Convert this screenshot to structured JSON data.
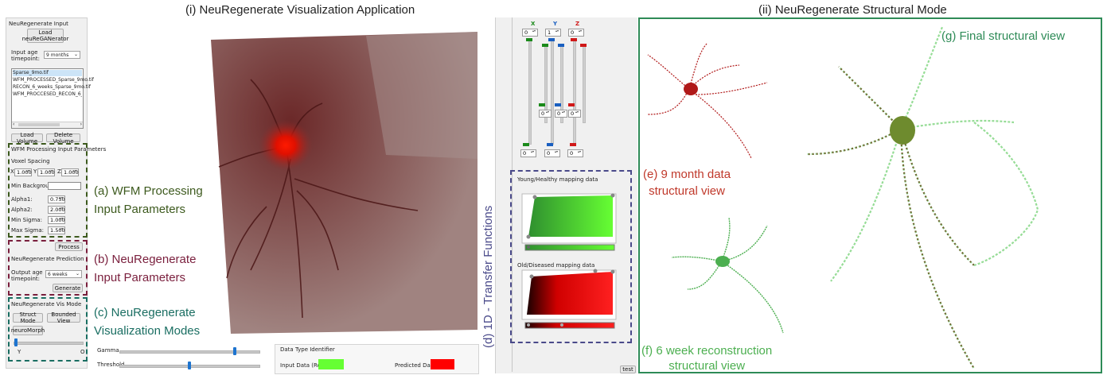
{
  "headers": {
    "app_title": "(i) NeuRegenerate Visualization Application",
    "struct_title": "(ii) NeuRegenerate Structural Mode"
  },
  "left_panel": {
    "group_title": "NeuRegenerate Input",
    "load_button": "Load\nneuReGANerator",
    "input_age_label": "Input age\ntimepoint:",
    "input_age_value": "9 months",
    "volumes": [
      "Sparse_9mo.tif",
      "WFM_PROCESSED_Sparse_9mo.tif",
      "RECON_6_weeks_Sparse_9mo.tif",
      "WFM_PROCCESED_RECON_6_wee"
    ],
    "load_volume": "Load Volume",
    "delete_volume": "Delete Volume",
    "wfm_title": "WFM Processing Input Parameters",
    "voxel_spacing_label": "Voxel Spacing",
    "voxel": {
      "x_label": "X",
      "y_label": "Y",
      "z_label": "Z",
      "x": "1.000",
      "y": "1.000",
      "z": "1.000"
    },
    "min_background_label": "Min Background:",
    "alpha1_label": "Alpha1:",
    "alpha1": "0.750",
    "alpha2_label": "Alpha2:",
    "alpha2": "2.000",
    "min_sigma_label": "Min Sigma:",
    "min_sigma": "1.000",
    "max_sigma_label": "Max Sigma:",
    "max_sigma": "1.500",
    "process_button": "Process",
    "prediction_title": "NeuRegenerate Prediction",
    "output_age_label": "Output age\ntimepoint:",
    "output_age_value": "6 weeks",
    "generate_button": "Generate",
    "vis_title": "NeuRegenerate Vis Mode",
    "struct_mode": "Struct Mode",
    "bounded_view": "Bounded View",
    "neuro_morph": "neuroMorph",
    "slider_left_label": "Y",
    "slider_right_label": "O",
    "slider_value": 0.03
  },
  "annotations": {
    "a_line1": "(a) WFM Processing",
    "a_line2": "Input Parameters",
    "b_line1": "(b) NeuRegenerate",
    "b_line2": "Input Parameters",
    "c_line1": "(c) NeuRegenerate",
    "c_line2": "Visualization Modes",
    "d": "(d) 1D - Transfer Functions",
    "e_line1": "(e) 9 month data",
    "e_line2": "structural view",
    "f_line1": "(f) 6 week reconstruction",
    "f_line2": "structural view",
    "g": "(g) Final structural view",
    "colors": {
      "a": "#3d5a1e",
      "b": "#7a1f3d",
      "c": "#1a6e62",
      "d": "#4a4a8a",
      "e": "#c0392b",
      "f": "#4caf50",
      "g": "#2e8b57"
    }
  },
  "bottom_bar": {
    "gamma_label": "Gamma",
    "gamma_value": 0.83,
    "threshold_label": "Threshold",
    "threshold_value": 0.5,
    "data_type_title": "Data Type Identifier",
    "input_data_label": "Input Data (Real):",
    "predicted_label": "Predicted Data",
    "input_color": "#66ff33",
    "predicted_color": "#ff0000"
  },
  "color_controls": {
    "x_label": "X",
    "y_label": "Y",
    "z_label": "Z",
    "x_color": "#1a8a1a",
    "y_color": "#1a5fc0",
    "z_color": "#d01818",
    "top_values": [
      "0",
      "1",
      "0"
    ],
    "mid_values": [
      "0",
      "0",
      "0"
    ],
    "bottom_values": [
      "0",
      "0",
      "0"
    ]
  },
  "transfer": {
    "young_title": "Young/Healthy mapping data",
    "old_title": "Old/Diseased mapping data"
  },
  "test_button": "test"
}
